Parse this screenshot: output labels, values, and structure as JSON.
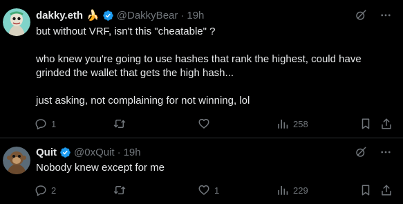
{
  "tweets": [
    {
      "display_name": "dakky.eth",
      "emoji": "🍌",
      "handle": "@DakkyBear",
      "separator": "·",
      "time": "19h",
      "paragraphs": [
        "but without VRF, isn't this \"cheatable\" ?",
        "",
        "who knew you're going to use hashes that rank the highest, could have grinded the wallet that gets the high hash...",
        "",
        "just asking, not complaining for not winning, lol"
      ],
      "reply_count": "1",
      "repost_count": "",
      "like_count": "",
      "view_count": "258"
    },
    {
      "display_name": "Quit",
      "handle": "@0xQuit",
      "separator": "·",
      "time": "19h",
      "paragraphs": [
        "Nobody knew except for me"
      ],
      "reply_count": "2",
      "repost_count": "",
      "like_count": "1",
      "view_count": "229"
    }
  ],
  "colors": {
    "background": "#000000",
    "text": "#e7e9ea",
    "muted": "#71767b",
    "verified": "#1d9bf0",
    "divider": "#2f3336"
  },
  "icons": [
    "grok-icon",
    "more-icon",
    "reply-icon",
    "repost-icon",
    "like-icon",
    "views-icon",
    "bookmark-icon",
    "share-icon",
    "verified-badge-icon"
  ]
}
